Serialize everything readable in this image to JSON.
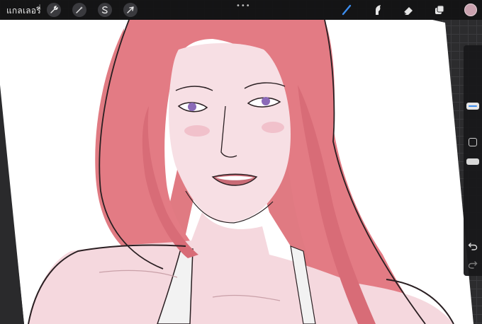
{
  "app": {
    "gallery_label": "แกลเลอรี่"
  },
  "toolbar_left": [
    {
      "name": "wrench-icon"
    },
    {
      "name": "magic-wand-icon"
    },
    {
      "name": "selection-icon"
    },
    {
      "name": "transform-arrow-icon"
    }
  ],
  "toolbar_right": [
    {
      "name": "brush-icon",
      "active": true,
      "color": "#3d8ef0"
    },
    {
      "name": "smudge-icon"
    },
    {
      "name": "eraser-icon"
    },
    {
      "name": "layers-icon"
    }
  ],
  "current_color": "#c9a1ae",
  "more_menu": "•••",
  "colors": {
    "hair": "#e07a82",
    "hair_dark": "#c45a66",
    "skin": "#f7dfe4",
    "skin_shadow": "#e9bfc8",
    "eyes": "#8b6ab8",
    "lines": "#2a1f22",
    "accent": "#3d8ef0"
  }
}
